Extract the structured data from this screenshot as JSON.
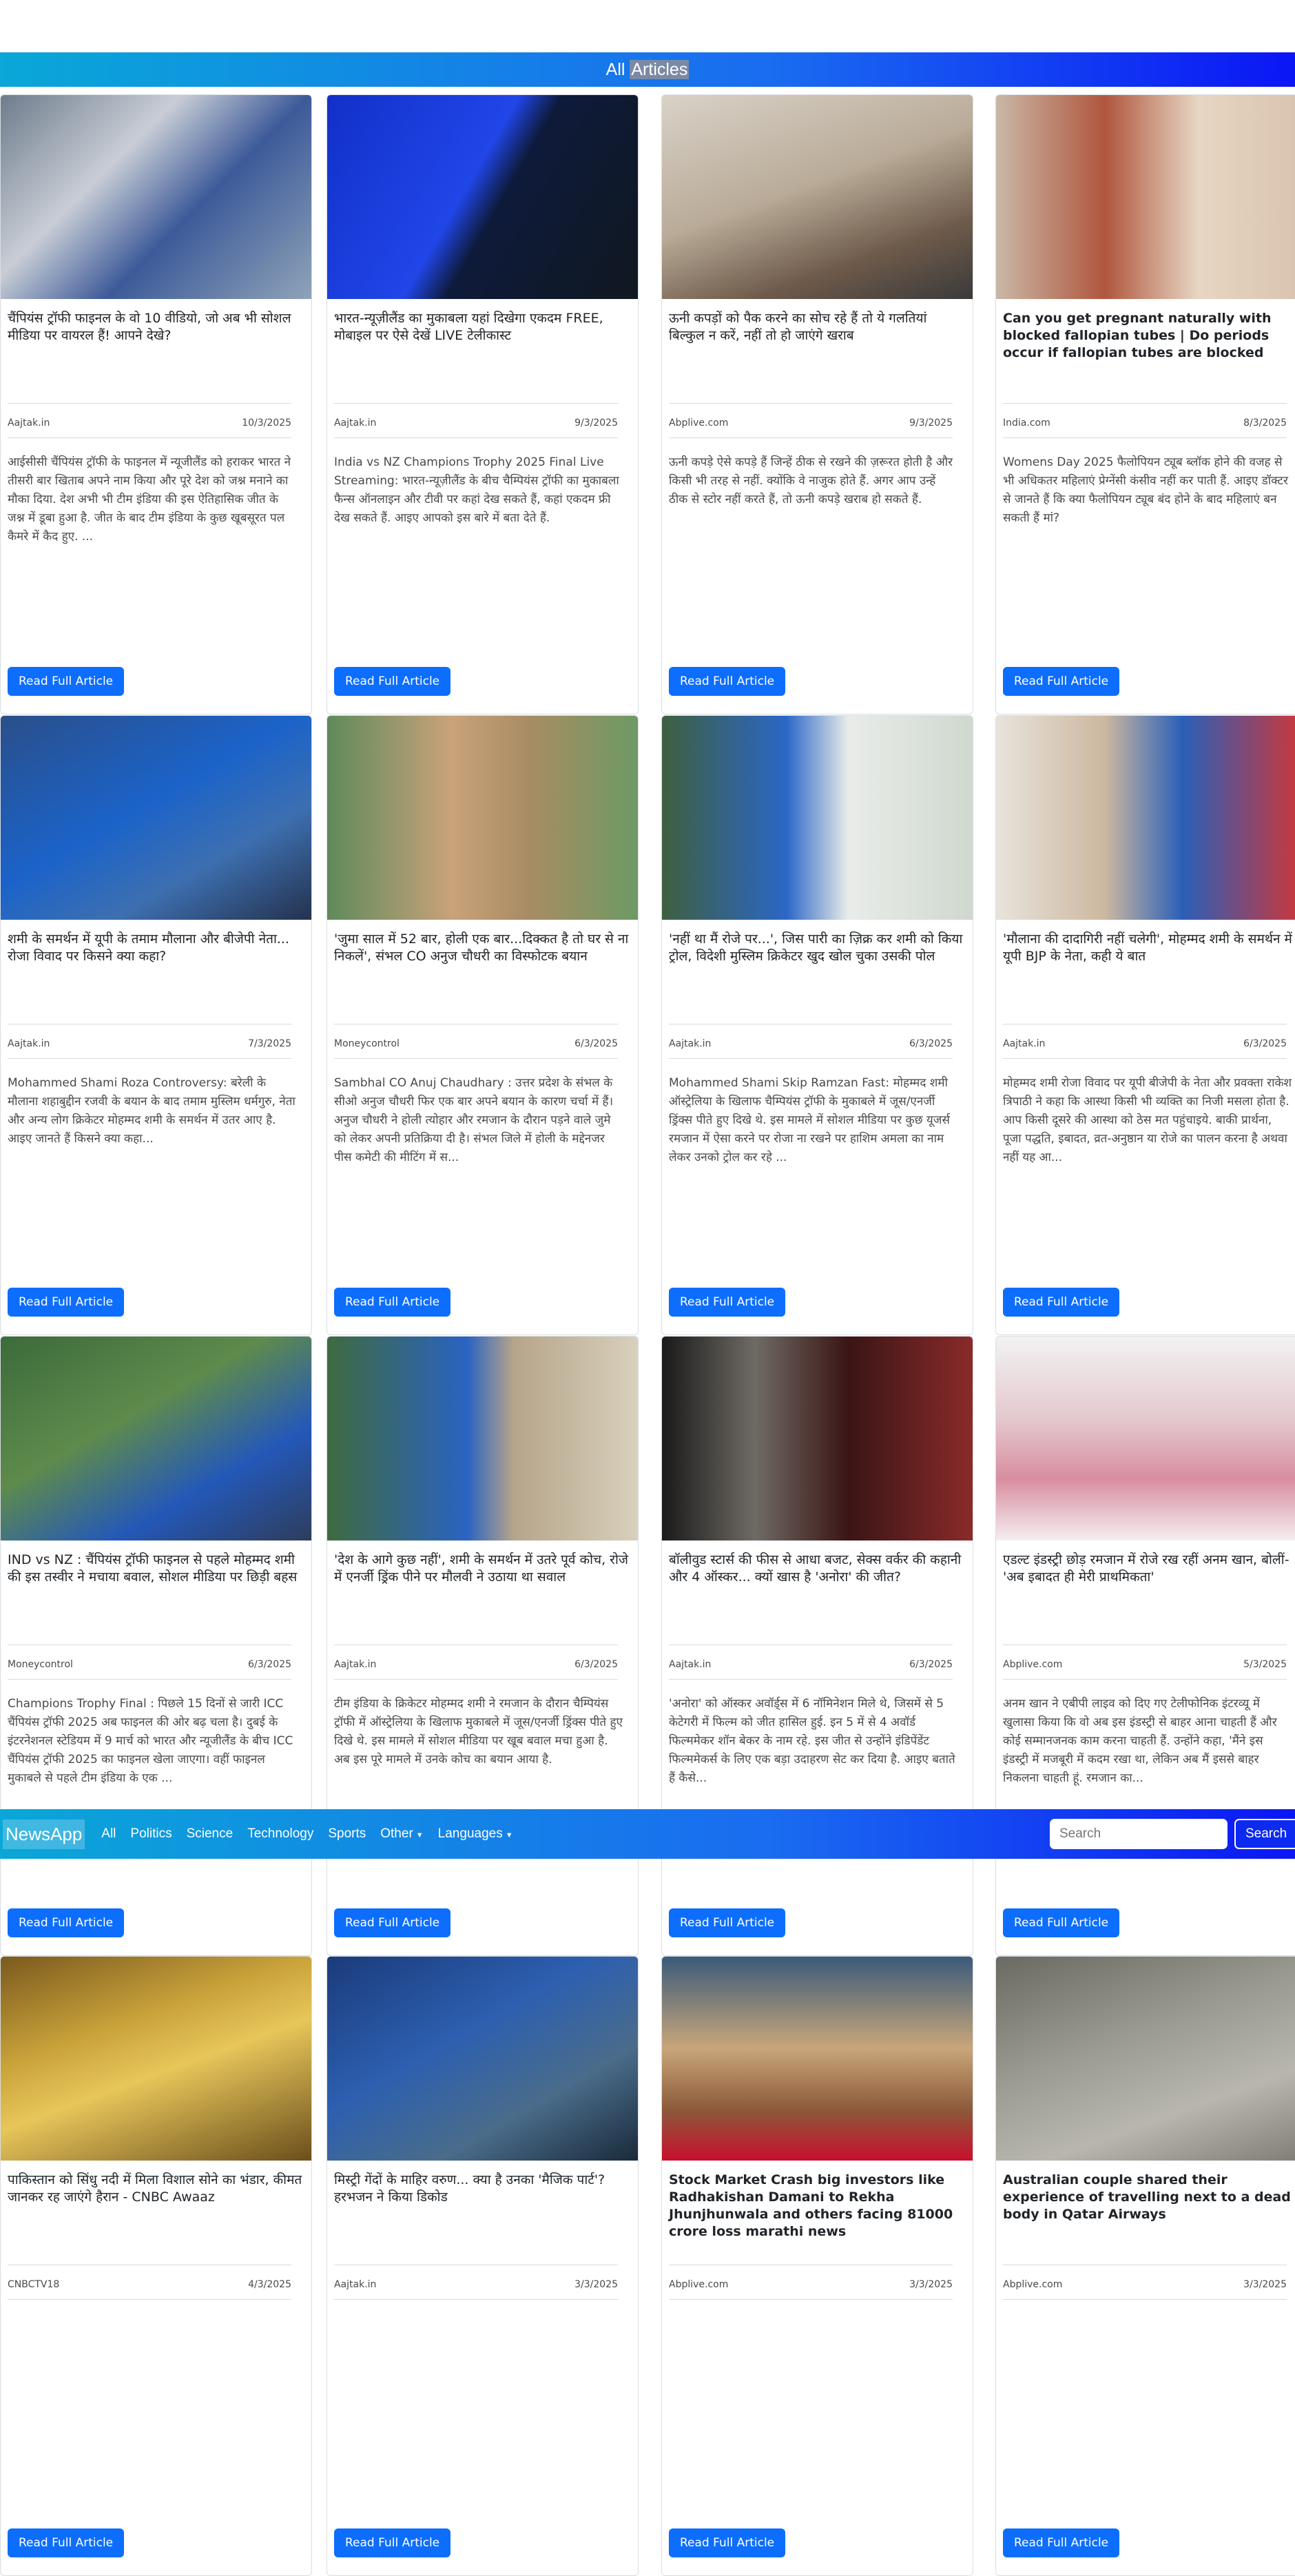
{
  "header": {
    "title_prefix": "All ",
    "title_highlight": "Articles"
  },
  "navbar": {
    "brand": "NewsApp",
    "links": [
      "All",
      "Politics",
      "Science",
      "Technology",
      "Sports"
    ],
    "dropdowns": [
      "Other",
      "Languages"
    ],
    "search_placeholder": "Search",
    "search_button": "Search"
  },
  "read_label": "Read Full Article",
  "articles": [
    {
      "title": "चैंपियंस ट्रॉफी फाइनल के वो 10 वीडियो, जो अब भी सोशल मीडिया पर वायरल हैं! आपने देखे?",
      "source": "Aajtak.in",
      "date": "10/3/2025",
      "desc": "आईसीसी चैंपियंस ट्रॉफी के फाइनल में न्यूजीलैंड को हराकर भारत ने तीसरी बार खिताब अपने नाम किया और पूरे देश को जश्न मनाने का मौका दिया. देश अभी भी टीम इंडिया की इस ऐतिहासिक जीत के जश्न में डूबा हुआ है. जीत के बाद टीम इंडिया के कुछ खूबसूरत पल कैमरे में कैद हुए. ...",
      "bold": false,
      "img": "linear-gradient(135deg,#6e7c8c 0%,#c9ced6 35%,#3d5a99 60%,#8fa3b8 100%)"
    },
    {
      "title": "भारत-न्यूज़ीलैंड का मुकाबला यहां दिखेगा एकदम FREE, मोबाइल पर ऐसे देखें LIVE टेलीकास्ट",
      "source": "Aajtak.in",
      "date": "9/3/2025",
      "desc": "India vs NZ Champions Trophy 2025 Final Live Streaming: भारत-न्यूज़ीलैंड के बीच चैम्पियंस ट्रॉफी का मुकाबला फैन्स ऑनलाइन और टीवी पर कहां देख सकते हैं, कहां एकदम फ्री देख सकते हैं. आइए आपको इस बारे में बता देते हैं.",
      "bold": false,
      "img": "linear-gradient(120deg,#1230c9 0%,#2046e8 45%,#0e1a3a 55%,#101820 100%)"
    },
    {
      "title": "ऊनी कपड़ों को पैक करने का सोच रहे हैं तो ये गलतियां बिल्कुल न करें, नहीं तो हो जाएंगे खराब",
      "source": "Abplive.com",
      "date": "9/3/2025",
      "desc": "ऊनी कपड़े ऐसे कपड़े हैं जिन्हें ठीक से रखने की ज़रूरत होती है और किसी भी तरह से नहीं. क्योंकि वे नाजुक होते हैं. अगर आप उन्हें ठीक से स्टोर नहीं करते हैं, तो ऊनी कपड़े खराब हो सकते हैं.",
      "bold": false,
      "img": "linear-gradient(160deg,#d9d2c8 0%,#b9ab98 45%,#6e5a4a 75%,#3a3a3a 100%)"
    },
    {
      "title": "Can you get pregnant naturally with blocked fallopian tubes | Do periods occur if fallopian tubes are blocked",
      "source": "India.com",
      "date": "8/3/2025",
      "desc": "Womens Day 2025 फैलोपियन ट्यूब ब्लॉक होने की वजह से भी अधिकतर महिलाएं प्रेग्नेंसी कंसीव नहीं कर पाती हैं. आइए डॉक्टर से जानते हैं कि क्या फैलोपियन ट्यूब बंद होने के बाद महिलाएं बन सकती हैं मां?",
      "bold": true,
      "img": "linear-gradient(90deg,#c9b8a6 0%,#b0563e 35%,#e7d6c3 65%,#d8c2ad 100%)"
    },
    {
      "title": "शमी के समर्थन में यूपी के तमाम मौलाना और बीजेपी नेता... रोजा विवाद पर किसने क्या कहा?",
      "source": "Aajtak.in",
      "date": "7/3/2025",
      "desc": "Mohammed Shami Roza Controversy: बरेली के मौलाना शहाबुद्दीन रजवी के बयान के बाद तमाम मुस्लिम धर्मगुरु, नेता और अन्य लोग क्रिकेटर मोहम्मद शमी के समर्थन में उतर आए है. आइए जानते हैं किसने क्या कहा...",
      "bold": false,
      "img": "linear-gradient(150deg,#2a4f8a 0%,#1b63c9 45%,#3d6fb0 70%,#24324d 100%)"
    },
    {
      "title": "'जुमा साल में 52 बार, होली एक बार...दिक्कत है तो घर से ना निकलें', संभल CO अनुज चौधरी का विस्फोटक बयान",
      "source": "Moneycontrol",
      "date": "6/3/2025",
      "desc": "Sambhal CO Anuj Chaudhary : उत्तर प्रदेश के संभल के सीओ अनुज चौधरी फिर एक बार अपने बयान के कारण चर्चा में हैं। अनुज चौधरी ने होली त्योहार और रमजान के दौरान पड़ने वाले जुमे को लेकर अपनी प्रतिक्रिया दी है। संभल जिले में होली के मद्देनजर पीस कमेटी की मीटिंग में स...",
      "bold": false,
      "img": "linear-gradient(90deg,#5f8a5b 0%,#c9a27a 40%,#a88c63 65%,#6d9a63 100%)"
    },
    {
      "title": "'नहीं था मैं रोजे पर...', जिस पारी का ज़िक्र कर शमी को किया ट्रोल, विदेशी मुस्लिम क्रिकेटर खुद खोल चुका उसकी पोल",
      "source": "Aajtak.in",
      "date": "6/3/2025",
      "desc": "Mohammed Shami Skip Ramzan Fast: मोहम्मद शमी ऑस्ट्रेलिया के खिलाफ चैम्पियंस ट्रॉफी के मुकाबले में जूस/एनर्जी ड्रिंक्स पीते हुए दिखे थे. इस मामले में सोशल मीडिया पर कुछ यूजर्स रमजान में ऐसा करने पर रोजा ना रखने पर हाशिम अमला का नाम लेकर उनको ट्रोल कर रहे ...",
      "bold": false,
      "img": "linear-gradient(90deg,#3f5f3f 0%,#2b67c7 40%,#e9ece9 60%,#cfd8cf 100%)"
    },
    {
      "title": "'मौलाना की दादागिरी नहीं चलेगी', मोहम्मद शमी के समर्थन में यूपी BJP के नेता, कही ये बात",
      "source": "Aajtak.in",
      "date": "6/3/2025",
      "desc": "मोहम्मद शमी रोजा विवाद पर यूपी बीजेपी के नेता और प्रवक्ता राकेश त्रिपाठी ने कहा कि आस्था किसी भी व्यक्ति का निजी मसला होता है. आप किसी दूसरे की आस्था को ठेस मत पहुंचाइये. बाकी प्रार्थना, पूजा पद्धति, इबादत, व्रत-अनुष्ठान या रोजे का पालन करना है अथवा नहीं यह आ...",
      "bold": false,
      "img": "linear-gradient(90deg,#e8e3dc 0%,#cdb8a0 35%,#2a5fb8 60%,#d43535 100%)"
    },
    {
      "title": "IND vs NZ : चैंपियंस ट्रॉफी फाइनल से पहले मोहम्मद शमी की इस तस्वीर ने मचाया बवाल, सोशल मीडिया पर छिड़ी बहस",
      "source": "Moneycontrol",
      "date": "6/3/2025",
      "desc": "Champions Trophy Final : पिछले 15 दिनों से जारी ICC चैंपियंस ट्रॉफी 2025 अब फाइनल की ओर बढ़ चला है। दुबई के इंटरनेशनल स्टेडियम में 9 मार्च को भारत और न्यूजीलैंड के बीच ICC चैंपियंस ट्रॉफी 2025 का फाइनल खेला जाएगा। वहीं फाइनल मुकाबले से पहले टीम इंडिया के एक ...",
      "bold": false,
      "img": "linear-gradient(150deg,#3c6a3a 0%,#5e8b4c 40%,#2458b8 70%,#2e3d5c 100%)"
    },
    {
      "title": "'देश के आगे कुछ नहीं', शमी के समर्थन में उतरे पूर्व कोच, रोजे में एनर्जी ड्रिंक पीने पर मौलवी ने उठाया था सवाल",
      "source": "Aajtak.in",
      "date": "6/3/2025",
      "desc": "टीम इंडिया के क्रिकेटर मोहम्मद शमी ने रमजान के दौरान चैम्पियंस ट्रॉफी में ऑस्ट्रेलिया के खिलाफ मुकाबले में जूस/एनर्जी ड्रिंक्स पीते हुए दिखे थे. इस मामले में सोशल मीडिया पर खूब बवाल मचा हुआ है. अब इस पूरे मामले में उनके कोच का बयान आया है.",
      "bold": false,
      "img": "linear-gradient(90deg,#3f6a3f 0%,#2a63c2 45%,#b6a58a 60%,#d8d0bc 100%)"
    },
    {
      "title": "बॉलीवुड स्टार्स की फीस से आधा बजट, सेक्स वर्कर की कहानी और 4 ऑस्कर... क्यों खास है 'अनोरा' की जीत?",
      "source": "Aajtak.in",
      "date": "6/3/2025",
      "desc": "'अनोरा' को ऑस्कर अवॉर्ड्स में 6 नॉमिनेशन मिले थे, जिसमें से 5 केटेगरी में फिल्म को जीत हासिल हुई. इन 5 में से 4 अवॉर्ड फिल्ममेकर शॉन बेकर के नाम रहे. इस जीत से उन्होंने इंडिपेंडेंट फिल्ममेकर्स के लिए एक बड़ा उदाहरण सेट कर दिया है. आइए बताते हैं कैसे...",
      "bold": false,
      "img": "linear-gradient(90deg,#1a1a1a 0%,#6f6a64 30%,#3a1515 60%,#8a2a2a 100%)"
    },
    {
      "title": "एडल्ट इंडस्ट्री छोड़ रमजान में रोजे रख रहीं अनम खान, बोलीं- 'अब इबादत ही मेरी प्राथमिकता'",
      "source": "Abplive.com",
      "date": "5/3/2025",
      "desc": "अनम खान ने एबीपी लाइव को दिए गए टेलीफोनिक इंटरव्यू में खुलासा किया कि वो अब इस इंडस्ट्री से बाहर आना चाहती हैं और कोई सम्मानजनक काम करना चाहती हैं. उन्होंने कहा, 'मैंने इस इंडस्ट्री में मजबूरी में कदम रखा था, लेकिन अब मैं इससे बाहर निकलना चाहती हूं. रमजान का...",
      "bold": false,
      "img": "linear-gradient(180deg,#f2f2f2 0%,#e4c9cf 40%,#d88ea0 70%,#f4eef0 100%)"
    },
    {
      "title": "पाकिस्तान को सिंधु नदी में मिला विशाल सोने का भंडार, कीमत जानकर रह जाएंगे हैरान - CNBC Awaaz",
      "source": "CNBCTV18",
      "date": "4/3/2025",
      "desc": "",
      "bold": false,
      "img": "linear-gradient(160deg,#7a5a1e 0%,#c9a23a 35%,#e7c65a 55%,#6b4f1c 100%)"
    },
    {
      "title": "मिस्ट्री गेंदों के माहिर वरुण... क्या है उनका 'मैजिक पार्ट'? हरभजन ने किया डिकोड",
      "source": "Aajtak.in",
      "date": "3/3/2025",
      "desc": "",
      "bold": false,
      "img": "linear-gradient(150deg,#1b3b7a 0%,#2c5fb0 40%,#4a6c8a 70%,#1a2a3a 100%)"
    },
    {
      "title": "Stock Market Crash big investors like Radhakishan Damani to Rekha Jhunjhunwala and others facing 81000 crore loss marathi news",
      "source": "Abplive.com",
      "date": "3/3/2025",
      "desc": "",
      "bold": true,
      "img": "linear-gradient(180deg,#3a5a7a 0%,#c9a67a 45%,#8c5a3a 75%,#c8102e 100%)"
    },
    {
      "title": "Australian couple shared their experience of travelling next to a dead body in Qatar Airways",
      "source": "Abplive.com",
      "date": "3/3/2025",
      "desc": "",
      "bold": true,
      "img": "linear-gradient(160deg,#6a6a62 0%,#9a9a90 40%,#b9b7ad 70%,#7e7c74 100%)"
    }
  ]
}
